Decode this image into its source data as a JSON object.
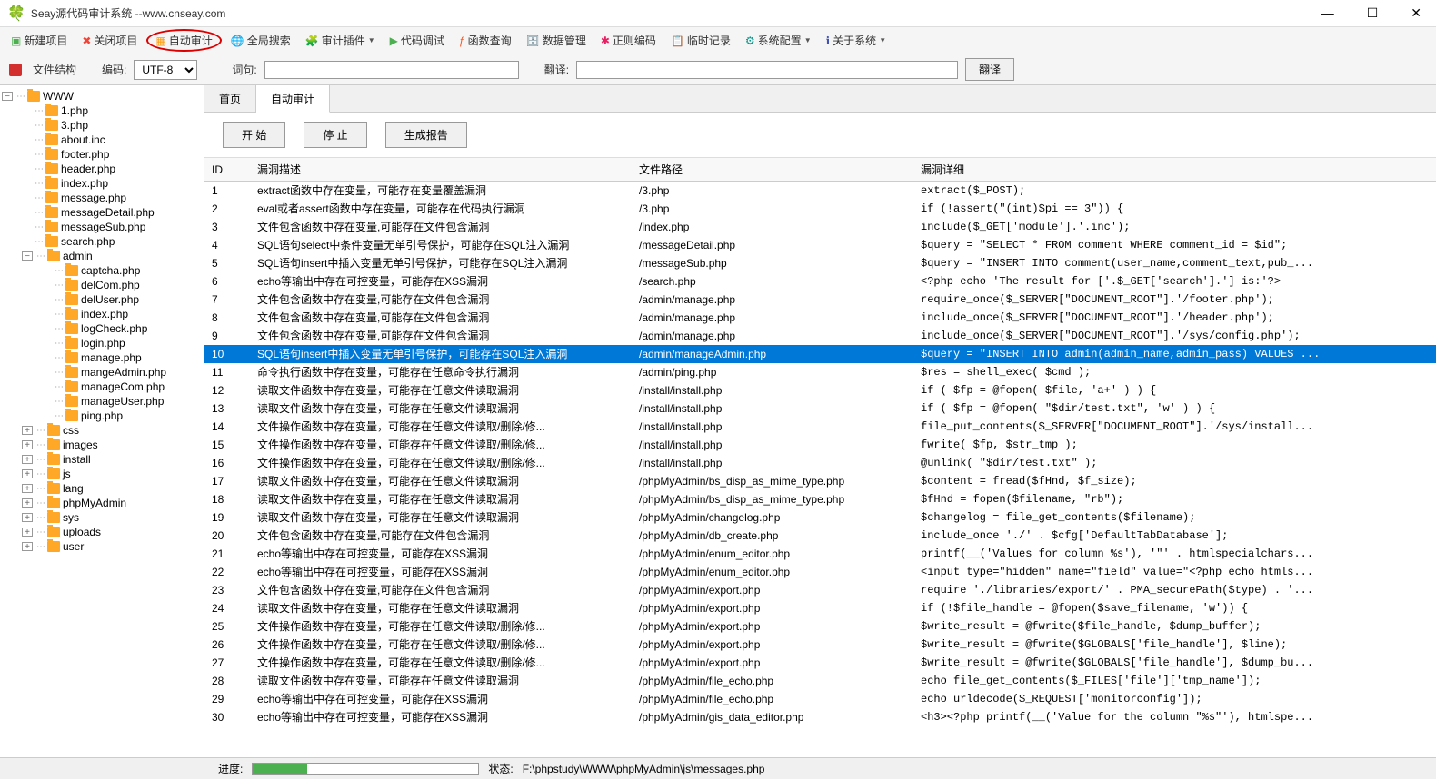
{
  "title": "Seay源代码审计系统  --www.cnseay.com",
  "toolbar": {
    "new_project": "新建项目",
    "close_project": "关闭项目",
    "auto_audit": "自动审计",
    "global_search": "全局搜索",
    "audit_plugin": "审计插件",
    "code_debug": "代码调试",
    "func_query": "函数查询",
    "data_manage": "数据管理",
    "regex_encode": "正则编码",
    "temp_record": "临时记录",
    "sys_config": "系统配置",
    "about": "关于系统"
  },
  "searchbar": {
    "file_struct": "文件结构",
    "encoding_label": "编码:",
    "encoding_value": "UTF-8",
    "seq_label": "词句:",
    "trans_label": "翻译:",
    "trans_btn": "翻译"
  },
  "tree": {
    "root": "WWW",
    "files": [
      "1.php",
      "3.php",
      "about.inc",
      "footer.php",
      "header.php",
      "index.php",
      "message.php",
      "messageDetail.php",
      "messageSub.php",
      "search.php"
    ],
    "admin": [
      "captcha.php",
      "delCom.php",
      "delUser.php",
      "index.php",
      "logCheck.php",
      "login.php",
      "manage.php",
      "mangeAdmin.php",
      "manageCom.php",
      "manageUser.php",
      "ping.php"
    ],
    "folders": [
      "css",
      "images",
      "install",
      "js",
      "lang",
      "phpMyAdmin",
      "sys",
      "uploads",
      "user"
    ]
  },
  "tabs": {
    "home": "首页",
    "auto": "自动审计"
  },
  "actions": {
    "start": "开 始",
    "stop": "停 止",
    "report": "生成报告"
  },
  "columns": {
    "id": "ID",
    "desc": "漏洞描述",
    "path": "文件路径",
    "detail": "漏洞详细"
  },
  "rows": [
    {
      "id": "1",
      "desc": "extract函数中存在变量，可能存在变量覆盖漏洞",
      "path": "/3.php",
      "detail": "extract($_POST);"
    },
    {
      "id": "2",
      "desc": "eval或者assert函数中存在变量，可能存在代码执行漏洞",
      "path": "/3.php",
      "detail": "if (!assert(\"(int)$pi == 3\")) {"
    },
    {
      "id": "3",
      "desc": "文件包含函数中存在变量,可能存在文件包含漏洞",
      "path": "/index.php",
      "detail": "include($_GET['module'].'.inc');"
    },
    {
      "id": "4",
      "desc": "SQL语句select中条件变量无单引号保护，可能存在SQL注入漏洞",
      "path": "/messageDetail.php",
      "detail": "$query = \"SELECT * FROM comment WHERE comment_id = $id\";"
    },
    {
      "id": "5",
      "desc": "SQL语句insert中插入变量无单引号保护，可能存在SQL注入漏洞",
      "path": "/messageSub.php",
      "detail": "$query = \"INSERT INTO comment(user_name,comment_text,pub_..."
    },
    {
      "id": "6",
      "desc": "echo等输出中存在可控变量，可能存在XSS漏洞",
      "path": "/search.php",
      "detail": "<?php echo 'The result for ['.$_GET['search'].'] is:'?>"
    },
    {
      "id": "7",
      "desc": "文件包含函数中存在变量,可能存在文件包含漏洞",
      "path": "/admin/manage.php",
      "detail": "require_once($_SERVER[\"DOCUMENT_ROOT\"].'/footer.php');"
    },
    {
      "id": "8",
      "desc": "文件包含函数中存在变量,可能存在文件包含漏洞",
      "path": "/admin/manage.php",
      "detail": "include_once($_SERVER[\"DOCUMENT_ROOT\"].'/header.php');"
    },
    {
      "id": "9",
      "desc": "文件包含函数中存在变量,可能存在文件包含漏洞",
      "path": "/admin/manage.php",
      "detail": "include_once($_SERVER[\"DOCUMENT_ROOT\"].'/sys/config.php');"
    },
    {
      "id": "10",
      "desc": "SQL语句insert中插入变量无单引号保护，可能存在SQL注入漏洞",
      "path": "/admin/manageAdmin.php",
      "detail": "$query = \"INSERT INTO admin(admin_name,admin_pass) VALUES ...",
      "selected": true
    },
    {
      "id": "11",
      "desc": "命令执行函数中存在变量，可能存在任意命令执行漏洞",
      "path": "/admin/ping.php",
      "detail": "$res = shell_exec( $cmd );"
    },
    {
      "id": "12",
      "desc": "读取文件函数中存在变量，可能存在任意文件读取漏洞",
      "path": "/install/install.php",
      "detail": "if ( $fp = @fopen( $file, 'a+' ) ) {"
    },
    {
      "id": "13",
      "desc": "读取文件函数中存在变量，可能存在任意文件读取漏洞",
      "path": "/install/install.php",
      "detail": "if ( $fp = @fopen( \"$dir/test.txt\", 'w' ) ) {"
    },
    {
      "id": "14",
      "desc": "文件操作函数中存在变量，可能存在任意文件读取/删除/修...",
      "path": "/install/install.php",
      "detail": "file_put_contents($_SERVER[\"DOCUMENT_ROOT\"].'/sys/install..."
    },
    {
      "id": "15",
      "desc": "文件操作函数中存在变量，可能存在任意文件读取/删除/修...",
      "path": "/install/install.php",
      "detail": "fwrite( $fp, $str_tmp );"
    },
    {
      "id": "16",
      "desc": "文件操作函数中存在变量，可能存在任意文件读取/删除/修...",
      "path": "/install/install.php",
      "detail": "@unlink( \"$dir/test.txt\" );"
    },
    {
      "id": "17",
      "desc": "读取文件函数中存在变量，可能存在任意文件读取漏洞",
      "path": "/phpMyAdmin/bs_disp_as_mime_type.php",
      "detail": "$content  = fread($fHnd, $f_size);"
    },
    {
      "id": "18",
      "desc": "读取文件函数中存在变量，可能存在任意文件读取漏洞",
      "path": "/phpMyAdmin/bs_disp_as_mime_type.php",
      "detail": "$fHnd = fopen($filename, \"rb\");"
    },
    {
      "id": "19",
      "desc": "读取文件函数中存在变量，可能存在任意文件读取漏洞",
      "path": "/phpMyAdmin/changelog.php",
      "detail": "$changelog = file_get_contents($filename);"
    },
    {
      "id": "20",
      "desc": "文件包含函数中存在变量,可能存在文件包含漏洞",
      "path": "/phpMyAdmin/db_create.php",
      "detail": "include_once './' . $cfg['DefaultTabDatabase'];"
    },
    {
      "id": "21",
      "desc": "echo等输出中存在可控变量，可能存在XSS漏洞",
      "path": "/phpMyAdmin/enum_editor.php",
      "detail": "printf(__('Values for column %s'), '\"' . htmlspecialchars..."
    },
    {
      "id": "22",
      "desc": "echo等输出中存在可控变量，可能存在XSS漏洞",
      "path": "/phpMyAdmin/enum_editor.php",
      "detail": "<input type=\"hidden\" name=\"field\" value=\"<?php echo htmls..."
    },
    {
      "id": "23",
      "desc": "文件包含函数中存在变量,可能存在文件包含漏洞",
      "path": "/phpMyAdmin/export.php",
      "detail": "require './libraries/export/' . PMA_securePath($type) . '..."
    },
    {
      "id": "24",
      "desc": "读取文件函数中存在变量，可能存在任意文件读取漏洞",
      "path": "/phpMyAdmin/export.php",
      "detail": "if (!$file_handle = @fopen($save_filename, 'w')) {"
    },
    {
      "id": "25",
      "desc": "文件操作函数中存在变量，可能存在任意文件读取/删除/修...",
      "path": "/phpMyAdmin/export.php",
      "detail": "$write_result = @fwrite($file_handle, $dump_buffer);"
    },
    {
      "id": "26",
      "desc": "文件操作函数中存在变量，可能存在任意文件读取/删除/修...",
      "path": "/phpMyAdmin/export.php",
      "detail": "$write_result = @fwrite($GLOBALS['file_handle'], $line);"
    },
    {
      "id": "27",
      "desc": "文件操作函数中存在变量，可能存在任意文件读取/删除/修...",
      "path": "/phpMyAdmin/export.php",
      "detail": "$write_result = @fwrite($GLOBALS['file_handle'], $dump_bu..."
    },
    {
      "id": "28",
      "desc": "读取文件函数中存在变量，可能存在任意文件读取漏洞",
      "path": "/phpMyAdmin/file_echo.php",
      "detail": "echo file_get_contents($_FILES['file']['tmp_name']);"
    },
    {
      "id": "29",
      "desc": "echo等输出中存在可控变量，可能存在XSS漏洞",
      "path": "/phpMyAdmin/file_echo.php",
      "detail": "echo urldecode($_REQUEST['monitorconfig']);"
    },
    {
      "id": "30",
      "desc": "echo等输出中存在可控变量，可能存在XSS漏洞",
      "path": "/phpMyAdmin/gis_data_editor.php",
      "detail": "<h3><?php printf(__('Value for the column \"%s\"'), htmlspe..."
    }
  ],
  "status": {
    "progress_label": "进度:",
    "status_label": "状态:",
    "status_text": "F:\\phpstudy\\WWW\\phpMyAdmin\\js\\messages.php"
  }
}
